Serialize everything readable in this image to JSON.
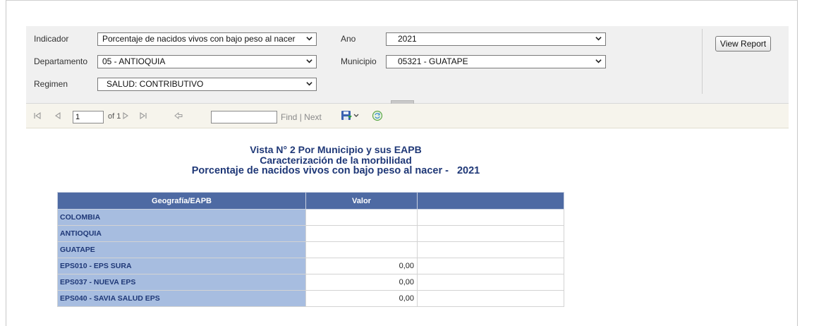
{
  "params": {
    "indicador_label": "Indicador",
    "indicador_value": "Porcentaje de nacidos vivos con bajo peso al nacer",
    "ano_label": "Ano",
    "ano_value": "2021",
    "departamento_label": "Departamento",
    "departamento_value": "05 - ANTIOQUIA",
    "municipio_label": "Municipio",
    "municipio_value": "05321 - GUATAPE",
    "regimen_label": "Regimen",
    "regimen_value": "SALUD: CONTRIBUTIVO",
    "view_report_label": "View Report"
  },
  "toolbar": {
    "page_value": "1",
    "of_pages": "of 1",
    "find_label": "Find",
    "separator": "|",
    "next_label": "Next",
    "icons": [
      "first-page-icon",
      "previous-page-icon",
      "next-page-icon",
      "last-page-icon",
      "back-icon",
      "save-export-icon",
      "refresh-icon"
    ]
  },
  "report": {
    "title1": "Vista N° 2 Por Municipio y sus EAPB",
    "title2": "Caracterización de la morbilidad",
    "title3": "Porcentaje de nacidos vivos con bajo peso al nacer -",
    "title3_year": "2021",
    "table": {
      "headers": [
        "Geografía/EAPB",
        "Valor",
        ""
      ],
      "rows": [
        {
          "geo": "COLOMBIA",
          "valor": "",
          "extra": ""
        },
        {
          "geo": "ANTIOQUIA",
          "valor": "",
          "extra": ""
        },
        {
          "geo": "GUATAPE",
          "valor": "",
          "extra": ""
        },
        {
          "geo": "EPS010 - EPS SURA",
          "valor": "0,00",
          "extra": ""
        },
        {
          "geo": "EPS037 - NUEVA EPS",
          "valor": "0,00",
          "extra": ""
        },
        {
          "geo": "EPS040 - SAVIA SALUD EPS",
          "valor": "0,00",
          "extra": ""
        }
      ]
    }
  },
  "colors": {
    "header_bg": "#4e6aa3",
    "geo_cell_bg": "#a7bde0",
    "title_color": "#1f3877",
    "params_bg": "#f0f0f0",
    "toolbar_bg": "#f6f4ec"
  }
}
